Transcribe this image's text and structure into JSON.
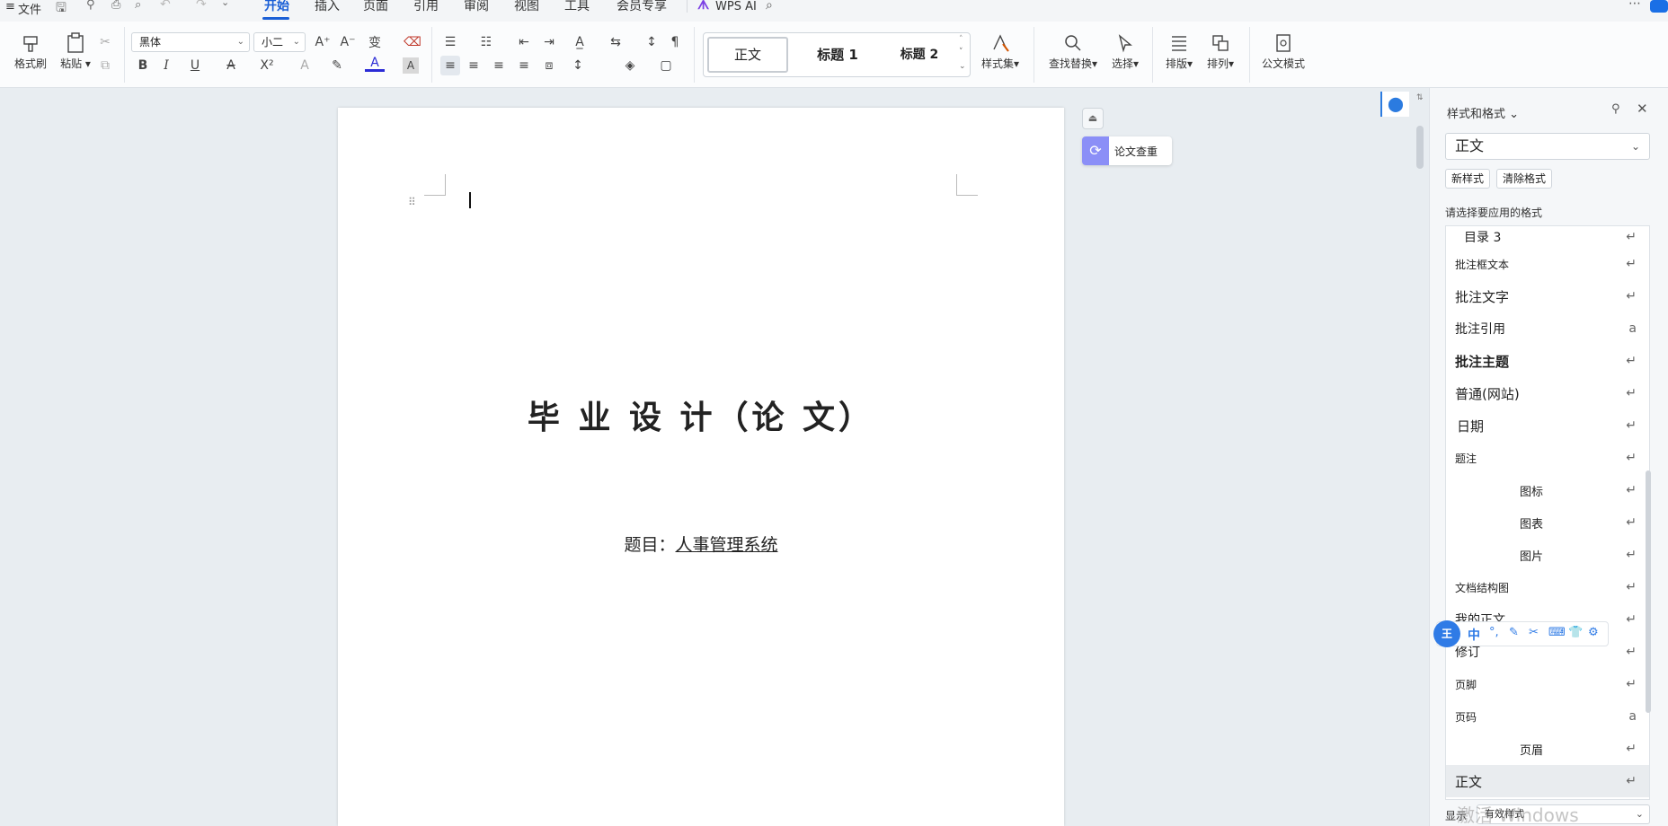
{
  "topbar": {
    "menu_label": "文件",
    "tabs": [
      "开始",
      "插入",
      "页面",
      "引用",
      "审阅",
      "视图",
      "工具",
      "会员专享"
    ],
    "active_tab": "开始",
    "ai_label": "WPS AI"
  },
  "ribbon": {
    "format_brush": "格式刷",
    "paste": "粘贴",
    "font_name": "黑体",
    "font_size": "小二",
    "styles": [
      "正文",
      "标题 1",
      "标题 2"
    ],
    "style_set": "样式集",
    "find_replace": "查找替换",
    "select": "选择",
    "layout": "排版",
    "arrange": "排列",
    "official_mode": "公文模式",
    "bold": "B",
    "italic": "I",
    "underline": "U",
    "superscript": "X²",
    "font_color_letter": "A",
    "shade_letter": "A"
  },
  "document": {
    "thesis_check": "论文查重",
    "title": "毕 业 设 计（论 文）",
    "subject_label": "题目：",
    "subject_value": "人事管理系统"
  },
  "panel": {
    "title": "样式和格式",
    "current_style": "正文",
    "new_style": "新样式",
    "clear_format": "清除格式",
    "hint": "请选择要应用的格式",
    "items": [
      {
        "label": "目录 3",
        "indent": 20,
        "size": 14,
        "bold": false,
        "mark": "↵"
      },
      {
        "label": "批注框文本",
        "indent": 10,
        "size": 12,
        "bold": false,
        "mark": "↵"
      },
      {
        "label": "批注文字",
        "indent": 10,
        "size": 15,
        "bold": false,
        "mark": "↵"
      },
      {
        "label": "批注引用",
        "indent": 10,
        "size": 14,
        "bold": false,
        "mark": "a"
      },
      {
        "label": "批注主题",
        "indent": 10,
        "size": 15,
        "bold": true,
        "mark": "↵"
      },
      {
        "label": "普通(网站)",
        "indent": 10,
        "size": 15,
        "bold": false,
        "mark": "↵"
      },
      {
        "label": "日期",
        "indent": 12,
        "size": 15,
        "bold": false,
        "mark": "↵"
      },
      {
        "label": "题注",
        "indent": 10,
        "size": 12,
        "bold": false,
        "mark": "↵"
      },
      {
        "label": "图标",
        "indent": 82,
        "size": 13,
        "bold": false,
        "mark": "↵"
      },
      {
        "label": "图表",
        "indent": 82,
        "size": 13,
        "bold": false,
        "mark": "↵"
      },
      {
        "label": "图片",
        "indent": 82,
        "size": 13,
        "bold": false,
        "mark": "↵"
      },
      {
        "label": "文档结构图",
        "indent": 10,
        "size": 12,
        "bold": false,
        "mark": "↵"
      },
      {
        "label": "我的正文",
        "indent": 10,
        "size": 14,
        "bold": false,
        "mark": "↵"
      },
      {
        "label": "修订",
        "indent": 10,
        "size": 14,
        "bold": false,
        "mark": "↵"
      },
      {
        "label": "页脚",
        "indent": 10,
        "size": 12,
        "bold": false,
        "mark": "↵"
      },
      {
        "label": "页码",
        "indent": 10,
        "size": 12,
        "bold": false,
        "mark": "a"
      },
      {
        "label": "页眉",
        "indent": 82,
        "size": 13,
        "bold": false,
        "mark": "↵"
      },
      {
        "label": "正文",
        "indent": 10,
        "size": 15,
        "bold": false,
        "mark": "↵"
      }
    ],
    "show_label": "显示",
    "show_value": "有效样式",
    "watermark": "激活 Windows"
  },
  "ime": {
    "logo": "王",
    "mode": "中"
  }
}
